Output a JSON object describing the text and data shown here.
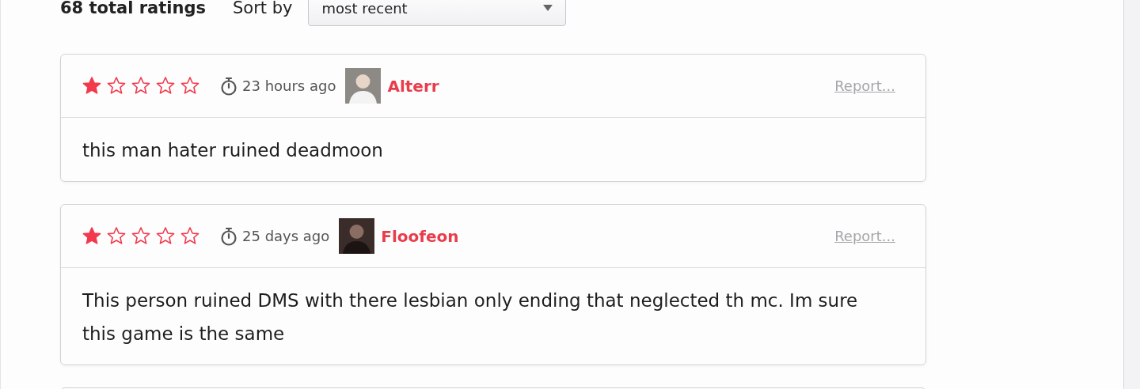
{
  "summary": {
    "total": "68 total ratings",
    "sort_label": "Sort by",
    "sort_value": "most recent"
  },
  "reviews": [
    {
      "stars": 1,
      "time": "23 hours ago",
      "author": "Alterr",
      "report": "Report...",
      "text": "this man hater ruined deadmoon"
    },
    {
      "stars": 1,
      "time": "25 days ago",
      "author": "Floofeon",
      "report": "Report...",
      "text": "This person ruined DMS with there lesbian only ending that neglected th mc. Im sure this game is the same"
    }
  ]
}
